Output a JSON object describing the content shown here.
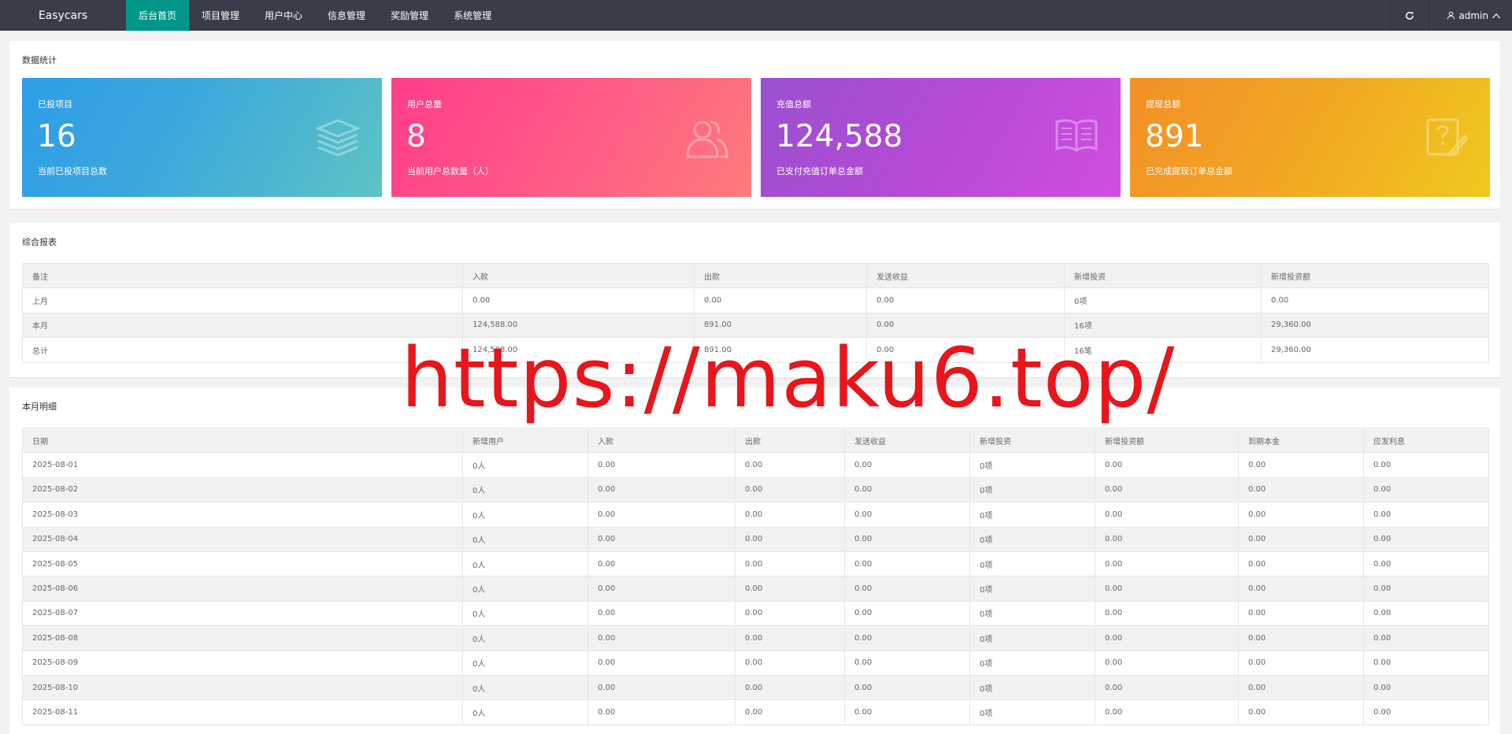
{
  "header": {
    "brand": "Easycars",
    "nav": [
      {
        "label": "后台首页",
        "active": true
      },
      {
        "label": "项目管理",
        "active": false
      },
      {
        "label": "用户中心",
        "active": false
      },
      {
        "label": "信息管理",
        "active": false
      },
      {
        "label": "奖励管理",
        "active": false
      },
      {
        "label": "系统管理",
        "active": false
      }
    ],
    "refresh_icon": "refresh-icon",
    "user_icon": "user-icon",
    "username": "admin",
    "chevron_icon": "chevron-up-icon"
  },
  "stats": {
    "title": "数据统计",
    "cards": [
      {
        "label": "已投项目",
        "value": "16",
        "desc": "当前已投项目总数",
        "icon": "layers-icon"
      },
      {
        "label": "用户总量",
        "value": "8",
        "desc": "当前用户总数量（人）",
        "icon": "users-icon"
      },
      {
        "label": "充值总额",
        "value": "124,588",
        "desc": "已支付充值订单总金额",
        "icon": "book-icon"
      },
      {
        "label": "提现总额",
        "value": "891",
        "desc": "已完成提现订单总金额",
        "icon": "question-edit-icon"
      }
    ]
  },
  "report": {
    "title": "综合报表",
    "columns": [
      "备注",
      "入款",
      "出款",
      "发送收益",
      "新增投资",
      "新增投资额"
    ],
    "rows": [
      [
        "上月",
        "0.00",
        "0.00",
        "0.00",
        "0项",
        "0.00"
      ],
      [
        "本月",
        "124,588.00",
        "891.00",
        "0.00",
        "16项",
        "29,360.00"
      ],
      [
        "总计",
        "124,588.00",
        "891.00",
        "0.00",
        "16笔",
        "29,360.00"
      ]
    ]
  },
  "monthly": {
    "title": "本月明细",
    "columns": [
      "日期",
      "新增用户",
      "入款",
      "出款",
      "发送收益",
      "新增投资",
      "新增投资额",
      "到期本金",
      "应发利息"
    ],
    "rows": [
      [
        "2025-08-01",
        "0人",
        "0.00",
        "0.00",
        "0.00",
        "0项",
        "0.00",
        "0.00",
        "0.00"
      ],
      [
        "2025-08-02",
        "0人",
        "0.00",
        "0.00",
        "0.00",
        "0项",
        "0.00",
        "0.00",
        "0.00"
      ],
      [
        "2025-08-03",
        "0人",
        "0.00",
        "0.00",
        "0.00",
        "0项",
        "0.00",
        "0.00",
        "0.00"
      ],
      [
        "2025-08-04",
        "0人",
        "0.00",
        "0.00",
        "0.00",
        "0项",
        "0.00",
        "0.00",
        "0.00"
      ],
      [
        "2025-08-05",
        "0人",
        "0.00",
        "0.00",
        "0.00",
        "0项",
        "0.00",
        "0.00",
        "0.00"
      ],
      [
        "2025-08-06",
        "0人",
        "0.00",
        "0.00",
        "0.00",
        "0项",
        "0.00",
        "0.00",
        "0.00"
      ],
      [
        "2025-08-07",
        "0人",
        "0.00",
        "0.00",
        "0.00",
        "0项",
        "0.00",
        "0.00",
        "0.00"
      ],
      [
        "2025-08-08",
        "0人",
        "0.00",
        "0.00",
        "0.00",
        "0项",
        "0.00",
        "0.00",
        "0.00"
      ],
      [
        "2025-08-09",
        "0人",
        "0.00",
        "0.00",
        "0.00",
        "0项",
        "0.00",
        "0.00",
        "0.00"
      ],
      [
        "2025-08-10",
        "0人",
        "0.00",
        "0.00",
        "0.00",
        "0项",
        "0.00",
        "0.00",
        "0.00"
      ],
      [
        "2025-08-11",
        "0人",
        "0.00",
        "0.00",
        "0.00",
        "0项",
        "0.00",
        "0.00",
        "0.00"
      ]
    ]
  },
  "watermark": "https://maku6.top/",
  "colors": {
    "topbar": "#393d49",
    "nav_active": "#009688",
    "watermark": "#e8151b"
  }
}
